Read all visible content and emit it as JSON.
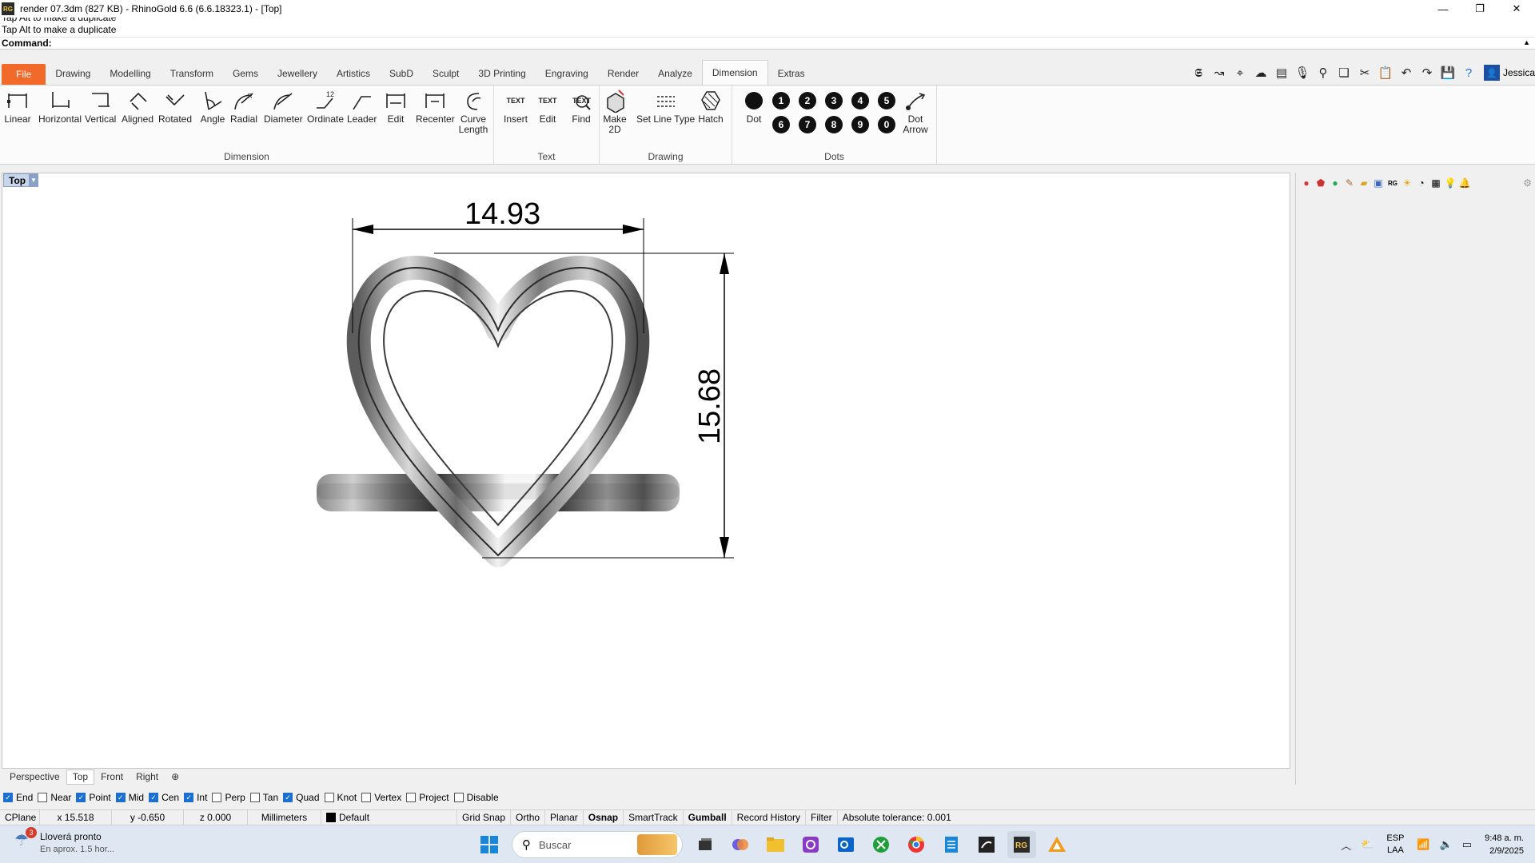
{
  "window": {
    "app_icon": "RG",
    "title": "render 07.3dm (827 KB) - RhinoGold 6.6 (6.6.18323.1) - [Top]",
    "minimize": "—",
    "maximize": "❐",
    "close": "✕"
  },
  "command": {
    "history": [
      "Tap Alt to make a duplicate",
      "Tap Alt to make a duplicate"
    ],
    "prompt": "Command:"
  },
  "ribbon_tabs": [
    "File",
    "Drawing",
    "Modelling",
    "Transform",
    "Gems",
    "Jewellery",
    "Artistics",
    "SubD",
    "Sculpt",
    "3D Printing",
    "Engraving",
    "Render",
    "Analyze",
    "Dimension",
    "Extras"
  ],
  "active_tab": "Dimension",
  "user": {
    "name": "Jessica"
  },
  "ribbon": {
    "dimension_group": {
      "label": "Dimension",
      "buttons": [
        "Linear",
        "Horizontal",
        "Vertical",
        "Aligned",
        "Rotated",
        "Angle",
        "Radial",
        "Diameter",
        "Ordinate",
        "Leader",
        "Edit",
        "Recenter",
        "Curve Length"
      ]
    },
    "text_group": {
      "label": "Text",
      "buttons": [
        "Insert",
        "Edit",
        "Find"
      ],
      "icon_text": "TEXT"
    },
    "drawing_group": {
      "label": "Drawing",
      "buttons": [
        "Make 2D",
        "Set Line Type",
        "Hatch"
      ]
    },
    "dots_group": {
      "label": "Dots",
      "dot_label": "Dot",
      "arrow_label": "Dot Arrow",
      "numbers_row1": [
        "1",
        "2",
        "3",
        "4",
        "5"
      ],
      "numbers_row2": [
        "6",
        "7",
        "8",
        "9",
        "0"
      ]
    }
  },
  "viewport": {
    "name": "Top",
    "dim_horizontal": "14.93",
    "dim_vertical": "15.68"
  },
  "viewport_tabs": [
    "Perspective",
    "Top",
    "Front",
    "Right",
    "⊕"
  ],
  "active_viewport_tab": "Top",
  "osnap": [
    {
      "label": "End",
      "checked": true
    },
    {
      "label": "Near",
      "checked": false
    },
    {
      "label": "Point",
      "checked": true
    },
    {
      "label": "Mid",
      "checked": true
    },
    {
      "label": "Cen",
      "checked": true
    },
    {
      "label": "Int",
      "checked": true
    },
    {
      "label": "Perp",
      "checked": false
    },
    {
      "label": "Tan",
      "checked": false
    },
    {
      "label": "Quad",
      "checked": true
    },
    {
      "label": "Knot",
      "checked": false
    },
    {
      "label": "Vertex",
      "checked": false
    },
    {
      "label": "Project",
      "checked": false
    },
    {
      "label": "Disable",
      "checked": false
    }
  ],
  "status": {
    "cplane": "CPlane",
    "x": "x 15.518",
    "y": "y -0.650",
    "z": "z 0.000",
    "units": "Millimeters",
    "layer": "Default",
    "grid_snap": "Grid Snap",
    "ortho": "Ortho",
    "planar": "Planar",
    "osnap": "Osnap",
    "smarttrack": "SmartTrack",
    "gumball": "Gumball",
    "record_history": "Record History",
    "filter": "Filter",
    "tolerance": "Absolute tolerance: 0.001"
  },
  "taskbar": {
    "weather_badge": "3",
    "weather_title": "Lloverá pronto",
    "weather_sub": "En aprox. 1.5 hor...",
    "search_placeholder": "Buscar",
    "lang1": "ESP",
    "lang2": "LAA",
    "time": "9:48 a. m.",
    "date": "2/9/2025"
  },
  "colors": {
    "file_tab": "#f26a2a",
    "accent": "#1a6fd1",
    "viewport_title": "#c9d6ea"
  }
}
